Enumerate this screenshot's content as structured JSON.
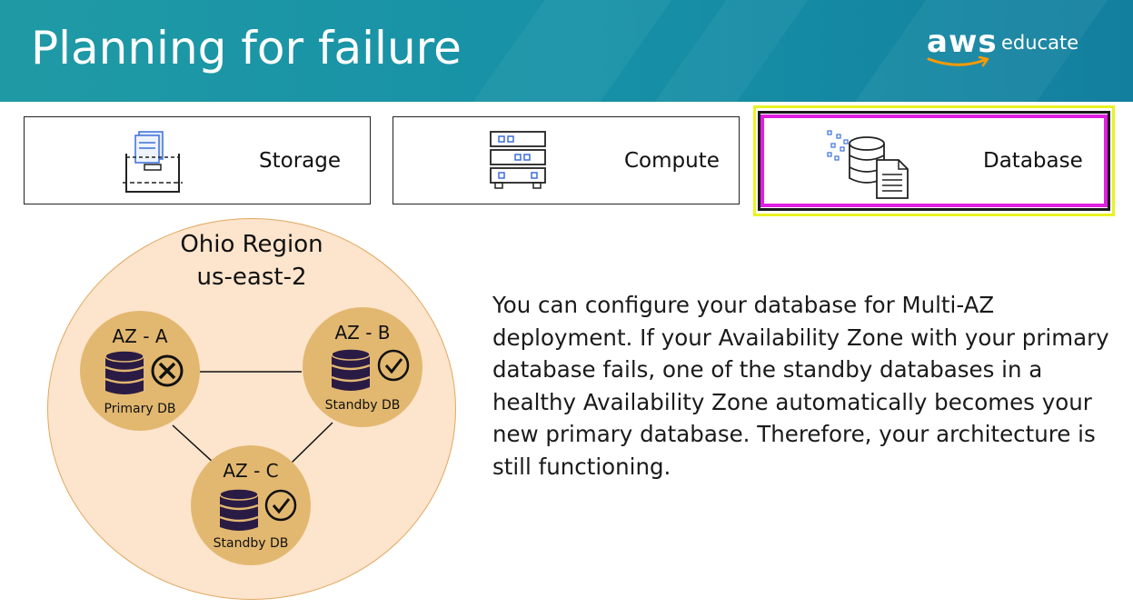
{
  "header": {
    "title": "Planning for failure"
  },
  "logo": {
    "brand": "aws",
    "product": "educate"
  },
  "cards": [
    {
      "label": "Storage",
      "icon": "storage-icon"
    },
    {
      "label": "Compute",
      "icon": "server-icon"
    },
    {
      "label": "Database",
      "icon": "database-icon",
      "selected": true
    }
  ],
  "diagram": {
    "region_name": "Ohio Region",
    "region_code": "us-east-2",
    "zones": [
      {
        "label": "AZ - A",
        "db_label": "Primary DB",
        "status": "failed",
        "status_icon": "x-circle-icon"
      },
      {
        "label": "AZ - B",
        "db_label": "Standby DB",
        "status": "healthy",
        "status_icon": "check-circle-icon"
      },
      {
        "label": "AZ - C",
        "db_label": "Standby DB",
        "status": "healthy",
        "status_icon": "check-circle-icon"
      }
    ]
  },
  "description": "You can configure your database for Multi-AZ deployment. If your Availability Zone with your primary database fails, one of the standby databases in a healthy Availability Zone automatically becomes your new primary database. Therefore, your architecture is still functioning.",
  "colors": {
    "header": "#1690a6",
    "selection_border": "#e020e0",
    "highlight_border": "#e9f221",
    "region_fill": "#fde4cc",
    "zone_fill": "#e2b870",
    "db_icon": "#2a1b45"
  }
}
